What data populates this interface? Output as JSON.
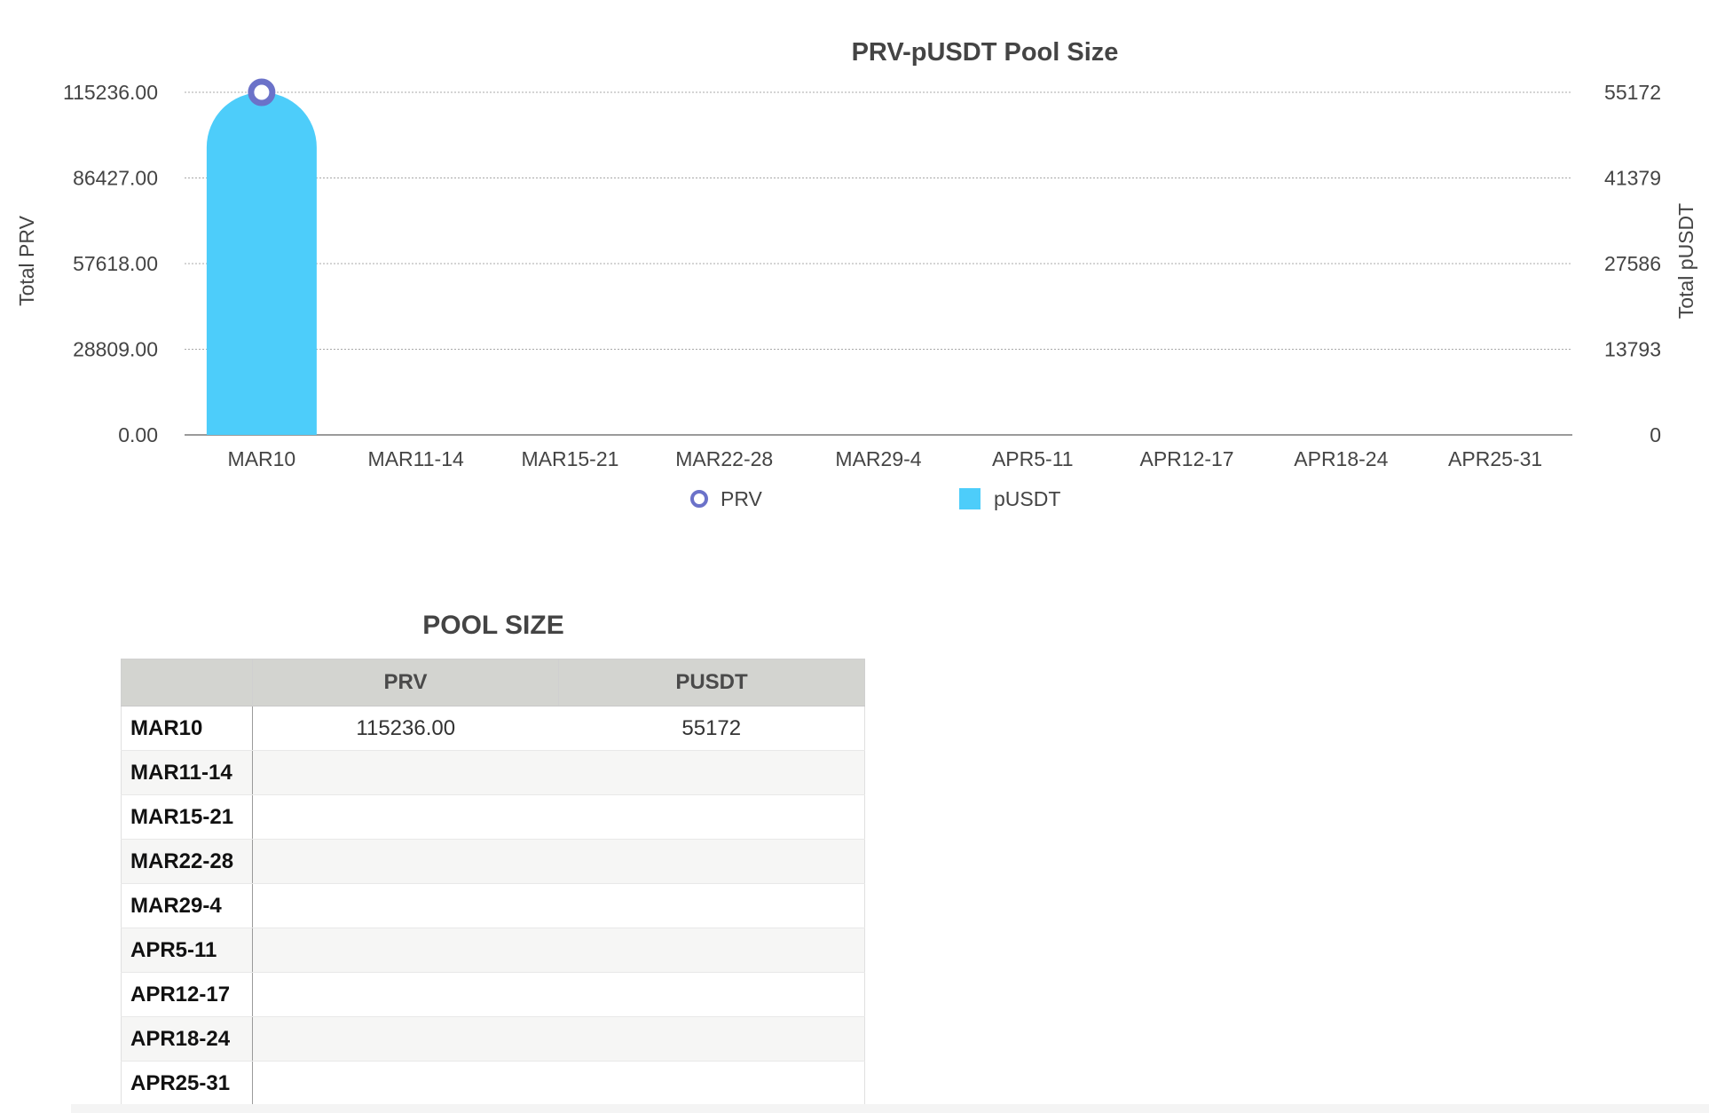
{
  "chart_data": {
    "type": "bar",
    "title": "PRV-pUSDT Pool Size",
    "categories": [
      "MAR10",
      "MAR11-14",
      "MAR15-21",
      "MAR22-28",
      "MAR29-4",
      "APR5-11",
      "APR12-17",
      "APR18-24",
      "APR25-31"
    ],
    "series": [
      {
        "name": "PRV",
        "kind": "point",
        "axis": "left",
        "color": "#6b72c9",
        "values": [
          115236.0,
          null,
          null,
          null,
          null,
          null,
          null,
          null,
          null
        ]
      },
      {
        "name": "pUSDT",
        "kind": "bar",
        "axis": "right",
        "color": "#4dcdfa",
        "values": [
          55172,
          null,
          null,
          null,
          null,
          null,
          null,
          null,
          null
        ]
      }
    ],
    "y_left": {
      "label": "Total PRV",
      "ylim": [
        0,
        115236
      ],
      "ticks": [
        "0.00",
        "28809.00",
        "57618.00",
        "86427.00",
        "115236.00"
      ]
    },
    "y_right": {
      "label": "Total pUSDT",
      "ylim": [
        0,
        55172
      ],
      "ticks": [
        "0",
        "13793",
        "27586",
        "41379",
        "55172"
      ]
    },
    "grid": true,
    "legend_position": "bottom"
  },
  "table": {
    "title": "POOL SIZE",
    "columns": [
      "",
      "PRV",
      "PUSDT"
    ],
    "rows": [
      {
        "label": "MAR10",
        "prv": "115236.00",
        "pusdt": "55172"
      },
      {
        "label": "MAR11-14",
        "prv": "",
        "pusdt": ""
      },
      {
        "label": "MAR15-21",
        "prv": "",
        "pusdt": ""
      },
      {
        "label": "MAR22-28",
        "prv": "",
        "pusdt": ""
      },
      {
        "label": "MAR29-4",
        "prv": "",
        "pusdt": ""
      },
      {
        "label": "APR5-11",
        "prv": "",
        "pusdt": ""
      },
      {
        "label": "APR12-17",
        "prv": "",
        "pusdt": ""
      },
      {
        "label": "APR18-24",
        "prv": "",
        "pusdt": ""
      },
      {
        "label": "APR25-31",
        "prv": "",
        "pusdt": ""
      }
    ]
  }
}
